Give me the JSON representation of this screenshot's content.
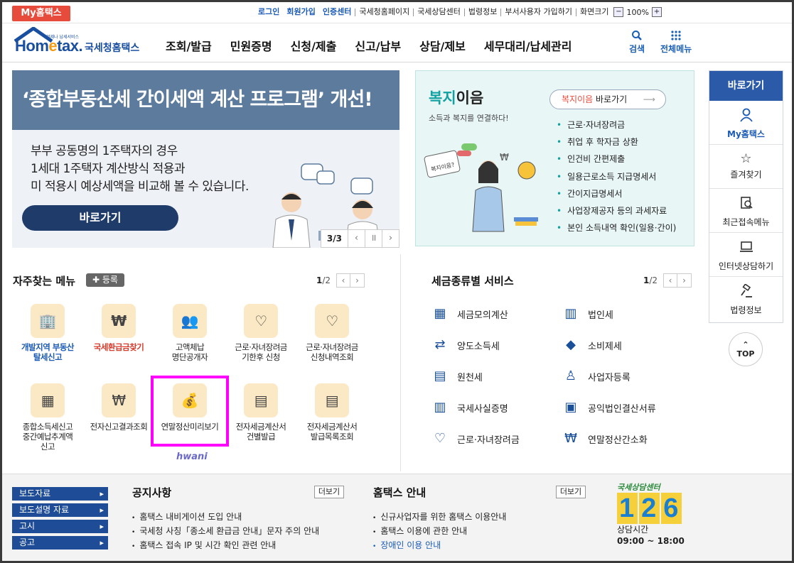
{
  "topbar": {
    "my_tab": "My홈택스",
    "links": [
      {
        "label": "로그인",
        "blue": true
      },
      {
        "label": "회원가입",
        "blue": true
      },
      {
        "label": "인증센터",
        "blue": true
      },
      {
        "label": "국세청홈페이지",
        "blue": false
      },
      {
        "label": "국세상담센터",
        "blue": false
      },
      {
        "label": "법령정보",
        "blue": false
      },
      {
        "label": "부서사용자 가입하기",
        "blue": false
      },
      {
        "label": "화면크기",
        "blue": false
      }
    ],
    "zoom_value": "100%",
    "zoom_minus": "−",
    "zoom_plus": "+"
  },
  "header": {
    "logo_small": "언제나 납세서비스",
    "logo_word_a": "Hom",
    "logo_word_e": "e",
    "logo_word_b": "tax.",
    "logo_ko": "국세청홈택스",
    "gnb": [
      "조회/발급",
      "민원증명",
      "신청/제출",
      "신고/납부",
      "상담/제보",
      "세무대리/납세관리"
    ],
    "search_label": "검색",
    "allmenu_label": "전체메뉴"
  },
  "banner": {
    "headline": "‘종합부동산세 간이세액 계산 프로그램’ 개선!",
    "body_lines": [
      "부부 공동명의 1주택자의 경우",
      "1세대 1주택자 계산방식 적용과",
      "미 적용시 예상세액을 비교해 볼 수 있습니다."
    ],
    "button": "바로가기",
    "page": "3/3"
  },
  "welfare": {
    "title_teal": "복지",
    "title_rest": "이음",
    "subtitle": "소득과 복지를 연결하다!",
    "button_red": "복지이음",
    "button_rest": " 바로가기",
    "bubble_text": "복지이음?",
    "items": [
      "근로·자녀장려금",
      "취업 후 학자금 상환",
      "인건비 간편제출",
      "일용근로소득 지급명세서",
      "간이지급명세서",
      "사업장제공자 등의 과세자료",
      "본인 소득내역 확인(일용·간이)"
    ]
  },
  "quick": {
    "header": "바로가기",
    "items": [
      {
        "label": "My홈택스",
        "icon": "person-icon"
      },
      {
        "label": "즐겨찾기",
        "icon": "star-icon"
      },
      {
        "label": "최근접속메뉴",
        "icon": "recent-icon"
      },
      {
        "label": "인터넷상담하기",
        "icon": "monitor-icon"
      },
      {
        "label": "법령정보",
        "icon": "gavel-icon"
      }
    ],
    "top_arrow": "⌃",
    "top_label": "TOP"
  },
  "frequent": {
    "title": "자주찾는 메뉴",
    "register": "✚ 등록",
    "page_current": "1",
    "page_total": "/2",
    "items": [
      {
        "label": "개발지역 부동산\n탈세신고",
        "icon": "building-money-icon",
        "style": "blue"
      },
      {
        "label": "국세환급금찾기",
        "icon": "coin-refund-icon",
        "style": "red"
      },
      {
        "label": "고액체납\n명단공개자",
        "icon": "people-search-icon",
        "style": ""
      },
      {
        "label": "근로·자녀장려금\n기한후 신청",
        "icon": "heart-hand-icon",
        "style": ""
      },
      {
        "label": "근로·자녀장려금\n신청내역조회",
        "icon": "heart-search-icon",
        "style": ""
      },
      {
        "label": "종합소득세신고\n중간예납추계액\n신고",
        "icon": "calendar-icon",
        "style": ""
      },
      {
        "label": "전자신고결과조회",
        "icon": "document-search-icon",
        "style": ""
      },
      {
        "label": "연말정산미리보기",
        "icon": "money-bag-icon",
        "style": ""
      },
      {
        "label": "전자세금계산서\n건별발급",
        "icon": "calculator-icon",
        "style": ""
      },
      {
        "label": "전자세금계산서\n발급목록조회",
        "icon": "list-search-icon",
        "style": ""
      }
    ],
    "watermark": "hwani"
  },
  "taxtypes": {
    "title": "세금종류별 서비스",
    "page_current": "1",
    "page_total": "/2",
    "left": [
      {
        "label": "세금모의계산",
        "icon": "calculator-icon"
      },
      {
        "label": "양도소득세",
        "icon": "transfer-doc-icon"
      },
      {
        "label": "원천세",
        "icon": "salary-doc-icon"
      },
      {
        "label": "국세사실증명",
        "icon": "certificate-icon"
      },
      {
        "label": "근로·자녀장려금",
        "icon": "heart-icon"
      }
    ],
    "right": [
      {
        "label": "법인세",
        "icon": "office-building-icon"
      },
      {
        "label": "소비제세",
        "icon": "diamond-icon"
      },
      {
        "label": "사업자등록",
        "icon": "user-icon"
      },
      {
        "label": "공익법인결산서류",
        "icon": "clipboard-icon"
      },
      {
        "label": "연말정산간소화",
        "icon": "won-search-icon"
      }
    ]
  },
  "footer": {
    "side_links": [
      "보도자료",
      "보도설명 자료",
      "고시",
      "공고"
    ],
    "notice_title": "공지사항",
    "notice_more": "더보기",
    "notices": [
      "홈택스 내비게이션 도입 안내",
      "국세청 사칭「종소세 환급금 안내」문자 주의 안내",
      "홈택스 접속 IP 및 시간 확인 관련 안내"
    ],
    "guide_title": "홈택스 안내",
    "guide_more": "더보기",
    "guides": [
      "신규사업자를 위한 홈택스 이용안내",
      "홈택스 이용에 관한 안내",
      "장애인 이용 안내"
    ],
    "center_caption": "국세상담센터",
    "center_number": [
      "1",
      "2",
      "6"
    ],
    "center_hours_label": "상담시간",
    "center_hours": "09:00 ~ 18:00"
  }
}
